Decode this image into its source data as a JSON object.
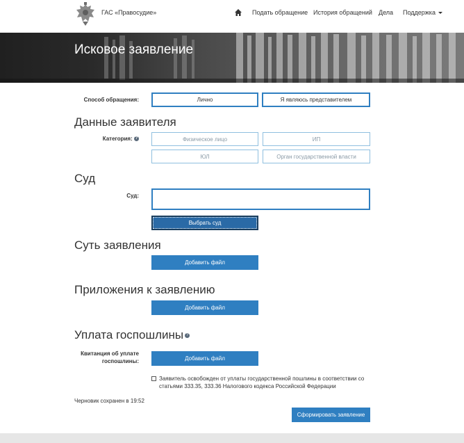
{
  "header": {
    "site_name": "ГАС «Правосудие»",
    "nav": {
      "home_icon": "home-icon",
      "submit": "Подать обращение",
      "history": "История обращений",
      "cases": "Дела",
      "support": "Поддержка"
    }
  },
  "banner": {
    "title": "Исковое заявление"
  },
  "form": {
    "method": {
      "label": "Способ обращения:",
      "options": [
        "Лично",
        "Я являюсь представителем"
      ]
    },
    "applicant": {
      "section_title": "Данные заявителя",
      "category_label": "Категория:",
      "categories": [
        "Физическое лицо",
        "ИП",
        "ЮЛ",
        "Орган государственной власти"
      ]
    },
    "court": {
      "section_title": "Суд",
      "label": "Суд:",
      "value": "",
      "choose_button": "Выбрать суд"
    },
    "essence": {
      "section_title": "Суть заявления",
      "add_file": "Добавить файл"
    },
    "attachments": {
      "section_title": "Приложения к заявлению",
      "add_file": "Добавить файл"
    },
    "fee": {
      "section_title": "Уплата госпошлины",
      "receipt_label_1": "Квитанция об уплате",
      "receipt_label_2": "госпошлины:",
      "add_file": "Добавить файл",
      "exempt_line_1": "Заявитель освобожден от уплаты государственной пошлины в соответствии со",
      "exempt_line_2": "статьями 333.35, 333.36 Налогового кодекса Российской Федерации",
      "exempt_checked": false
    },
    "draft_status": "Черновик сохранен в 19:52",
    "submit_button": "Сформировать заявление"
  },
  "colors": {
    "accent": "#2f7fc1",
    "footer": "#e6e6e6"
  }
}
